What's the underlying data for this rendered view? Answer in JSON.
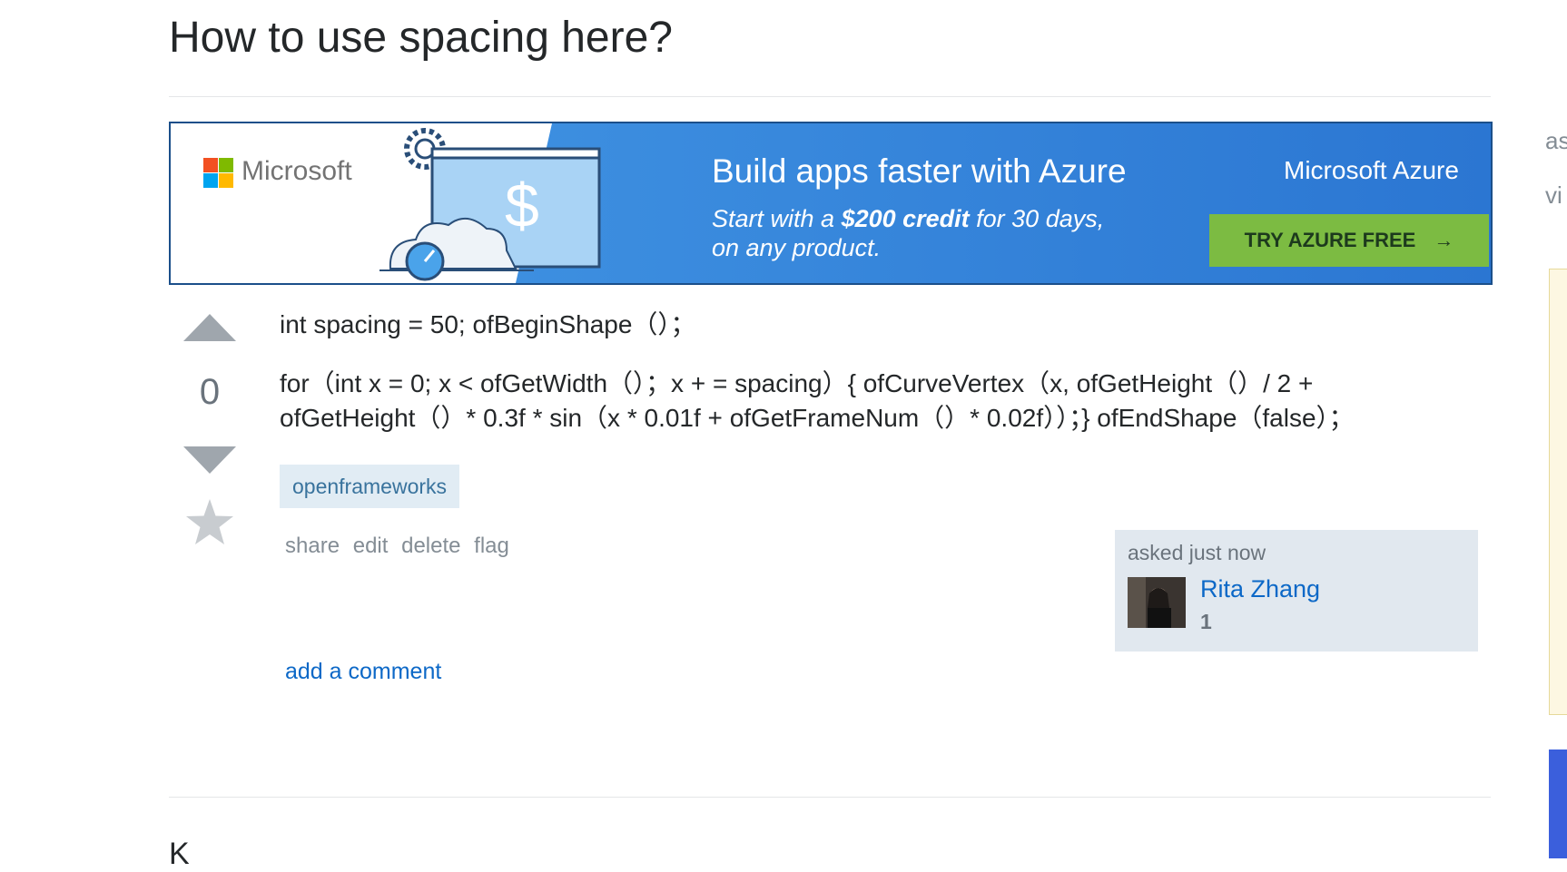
{
  "question": {
    "title": "How to use spacing here?",
    "vote_count": "0",
    "body_line1": "int spacing = 50; ofBeginShape（）；",
    "body_line2a": "for（int x = 0; x < ofGetWidth（）；x + = spacing）{ ofCurveVertex（x,  ofGetHeight（）/ 2 +",
    "body_line2b": "ofGetHeight（）* 0.3f * sin（x * 0.01f + ofGetFrameNum（）* 0.02f））；} ofEndShape（false）；",
    "tags": [
      "openframeworks"
    ],
    "menu": [
      "share",
      "edit",
      "delete",
      "flag"
    ],
    "add_comment": "add a comment"
  },
  "owner": {
    "asked": "asked just now",
    "name": "Rita Zhang",
    "reputation": "1"
  },
  "ad": {
    "company": "Microsoft",
    "headline": "Build apps faster with Azure",
    "sub_prefix": "Start with a ",
    "sub_bold": "$200 credit",
    "sub_suffix": " for 30 days,",
    "sub_line2": "on any product.",
    "brand": "Microsoft Azure",
    "cta": "TRY AZURE FREE",
    "cta_arrow": "→",
    "colors": {
      "banner_blue": "#2b7bd6",
      "cta_green": "#7cbb42",
      "ms_red": "#f25022",
      "ms_green": "#7fba00",
      "ms_blue": "#00a4ef",
      "ms_yellow": "#ffb900"
    }
  },
  "sidebar_fragments": [
    "as",
    "vi"
  ],
  "bottom_text": "K",
  "icons": {
    "upvote": "triangle-up",
    "downvote": "triangle-down",
    "favorite": "star"
  }
}
